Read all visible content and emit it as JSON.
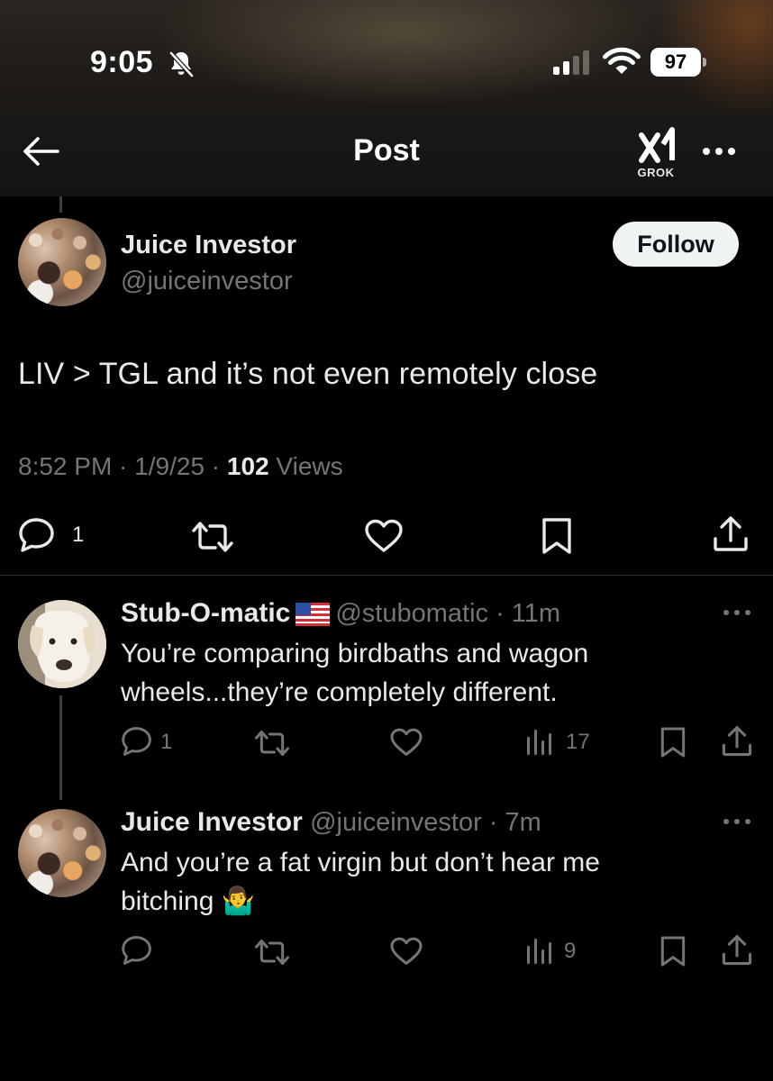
{
  "status_bar": {
    "time": "9:05",
    "battery": "97"
  },
  "nav": {
    "title": "Post",
    "grok_label": "GROK"
  },
  "post": {
    "author_name": "Juice Investor",
    "author_handle": "@juiceinvestor",
    "follow_label": "Follow",
    "text": "LIV > TGL and it’s not even remotely close",
    "time": "8:52 PM",
    "date": "1/9/25",
    "views_count": "102",
    "views_label": "Views",
    "reply_count": "1"
  },
  "replies": [
    {
      "author_name": "Stub-O-matic",
      "author_handle": "@stubomatic",
      "age": "11m",
      "text_line1": "You’re comparing birdbaths and wagon",
      "text_line2": "wheels...they’re completely different.",
      "reply_count": "1",
      "views": "17"
    },
    {
      "author_name": "Juice Investor",
      "author_handle": "@juiceinvestor",
      "age": "7m",
      "text_line1": "And you’re a fat virgin but don’t hear me",
      "text_line2": "bitching",
      "emoji": "🤷‍♂️",
      "views": "9"
    }
  ],
  "icons": {
    "back": "back-arrow-icon",
    "grok": "grok-icon",
    "more": "more-horizontal-icon",
    "reply": "reply-icon",
    "repost": "repost-icon",
    "like": "heart-icon",
    "views": "views-icon",
    "bookmark": "bookmark-icon",
    "share": "share-icon"
  },
  "colors": {
    "background": "#000000",
    "text": "#e7e9ea",
    "muted": "#71767b",
    "divider": "#2f3336",
    "follow_bg": "#eff3f4"
  }
}
